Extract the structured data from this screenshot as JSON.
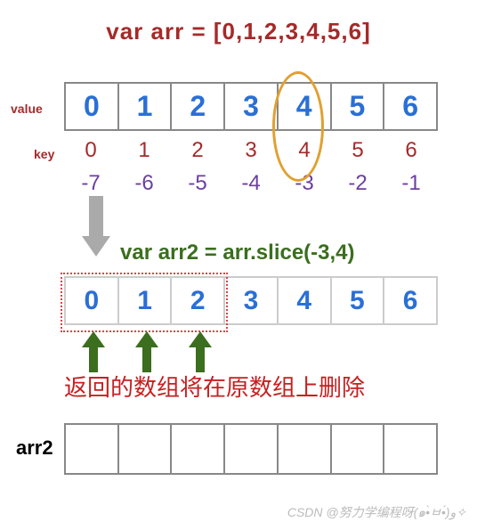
{
  "declaration": "var arr = [0,1,2,3,4,5,6]",
  "labels": {
    "value": "value",
    "key": "key",
    "arr2": "arr2"
  },
  "arr_values": [
    "0",
    "1",
    "2",
    "3",
    "4",
    "5",
    "6"
  ],
  "keys": [
    "0",
    "1",
    "2",
    "3",
    "4",
    "5",
    "6"
  ],
  "neg_keys": [
    "-7",
    "-6",
    "-5",
    "-4",
    "-3",
    "-2",
    "-1"
  ],
  "slice_code": "var arr2 = arr.slice(-3,4)",
  "slice_values": [
    "0",
    "1",
    "2",
    "3",
    "4",
    "5",
    "6"
  ],
  "caption": "返回的数组将在原数组上删除",
  "watermark": "CSDN @努力学编程呀(๑•̀ㅂ•́)و✧",
  "chart_data": {
    "type": "table",
    "title": "JavaScript Array.slice negative index diagram",
    "array": [
      0,
      1,
      2,
      3,
      4,
      5,
      6
    ],
    "positive_indices": [
      0,
      1,
      2,
      3,
      4,
      5,
      6
    ],
    "negative_indices": [
      -7,
      -6,
      -5,
      -4,
      -3,
      -2,
      -1
    ],
    "expression": "arr.slice(-3, 4)",
    "highlighted_value_index": 4,
    "returned_indices_highlight": [
      0,
      1,
      2
    ],
    "arr2_length_shown": 7
  }
}
